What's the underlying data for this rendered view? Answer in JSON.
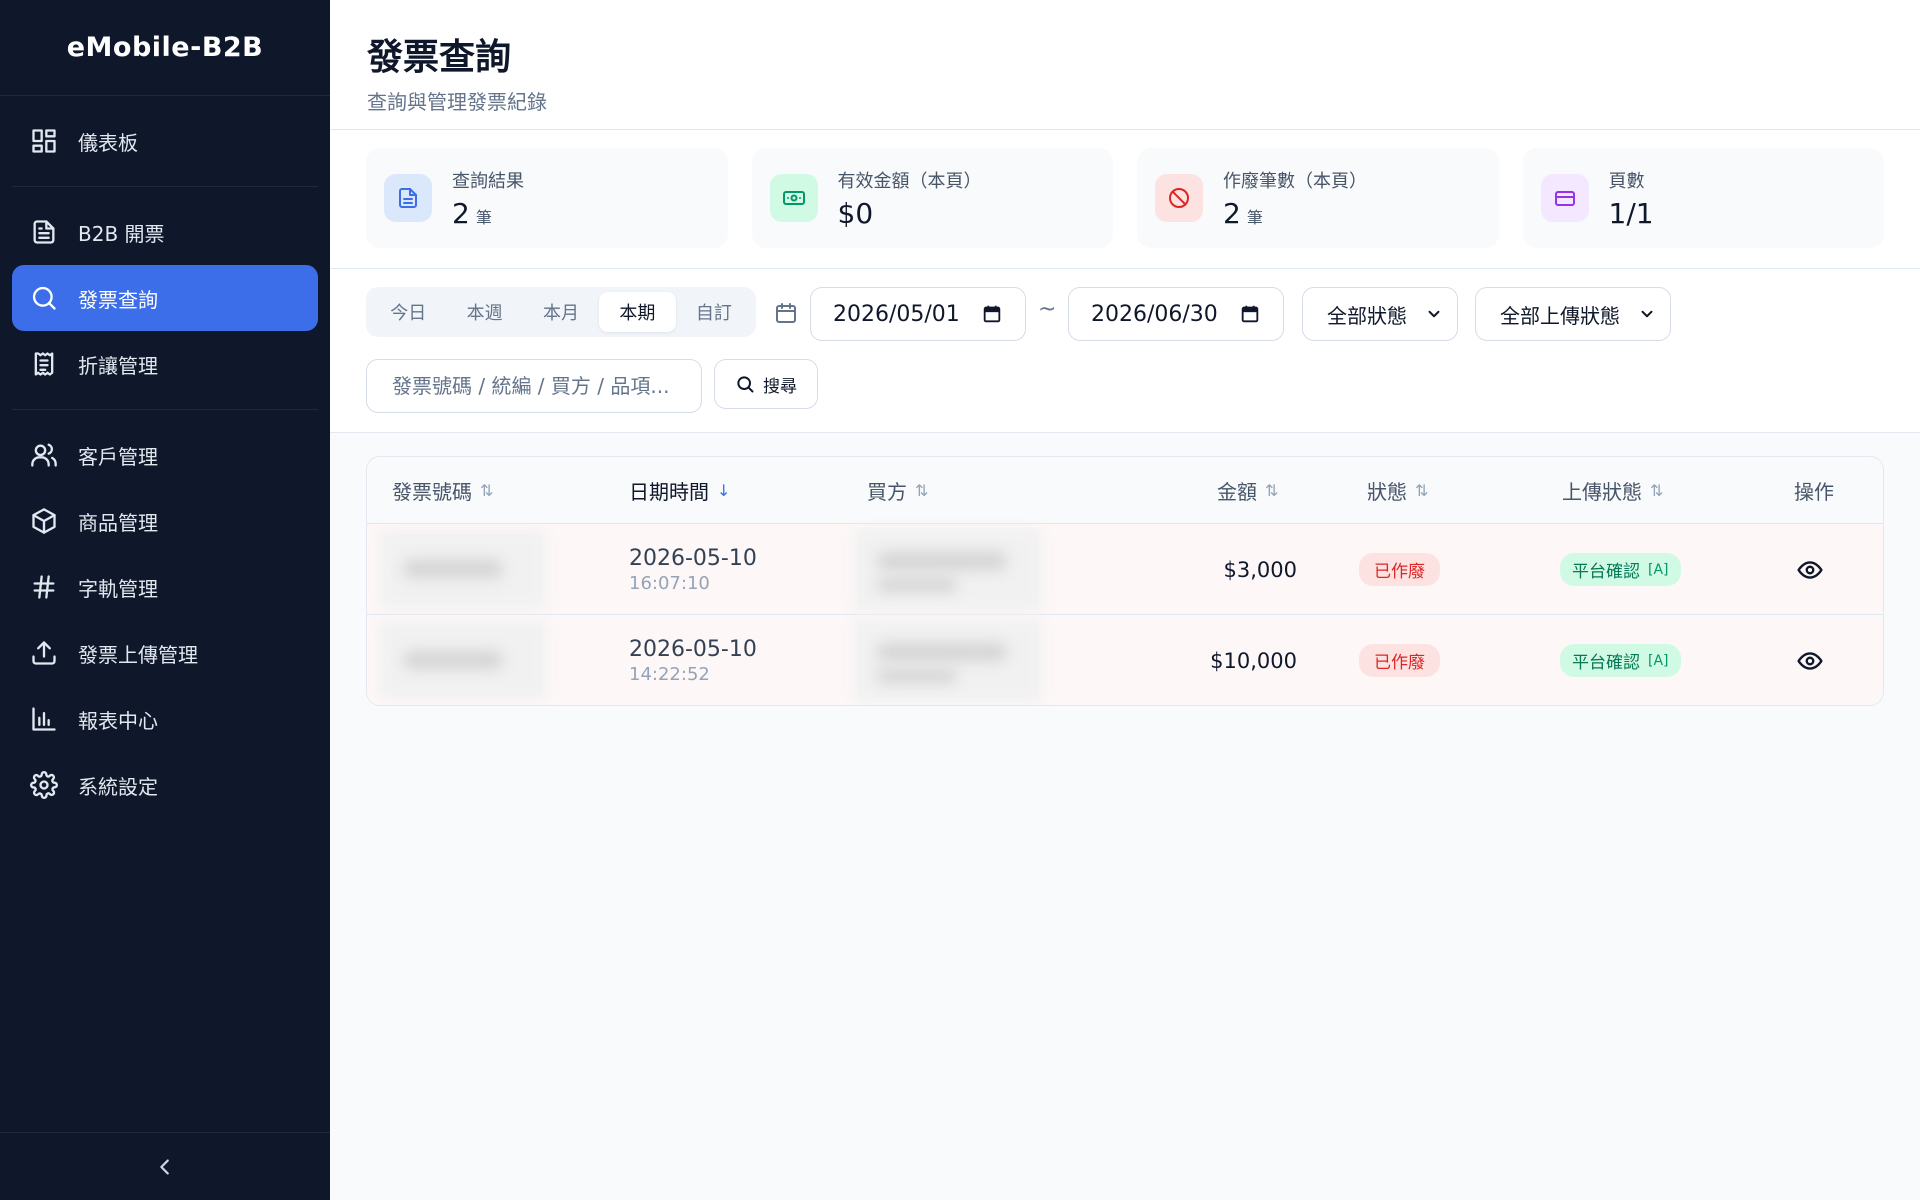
{
  "app": {
    "brand": "eMobile-B2B"
  },
  "sidebar": {
    "items": [
      {
        "label": "儀表板",
        "icon": "dashboard-grid-icon"
      },
      {
        "label": "B2B 開票",
        "icon": "document-icon"
      },
      {
        "label": "發票查詢",
        "icon": "search-icon",
        "active": true
      },
      {
        "label": "折讓管理",
        "icon": "receipt-icon"
      },
      {
        "label": "客戶管理",
        "icon": "users-icon"
      },
      {
        "label": "商品管理",
        "icon": "package-icon"
      },
      {
        "label": "字軌管理",
        "icon": "hash-icon"
      },
      {
        "label": "發票上傳管理",
        "icon": "upload-icon"
      },
      {
        "label": "報表中心",
        "icon": "bar-chart-icon"
      },
      {
        "label": "系統設定",
        "icon": "gear-icon"
      }
    ]
  },
  "header": {
    "title": "發票查詢",
    "subtitle": "查詢與管理發票紀錄"
  },
  "stats": [
    {
      "label": "查詢結果",
      "value": "2",
      "unit": "筆",
      "icon": "file-text-icon",
      "color": "#3b6ee8",
      "bg": "#dbe7fb"
    },
    {
      "label": "有效金額（本頁）",
      "value": "$0",
      "unit": "",
      "icon": "banknote-icon",
      "color": "#059669",
      "bg": "#d1fae5"
    },
    {
      "label": "作廢筆數（本頁）",
      "value": "2",
      "unit": "筆",
      "icon": "ban-icon",
      "color": "#dc2626",
      "bg": "#fde2e2"
    },
    {
      "label": "頁數",
      "value": "1/1",
      "unit": "",
      "icon": "credit-card-icon",
      "color": "#9333ea",
      "bg": "#f3e8ff"
    }
  ],
  "filters": {
    "ranges": [
      "今日",
      "本週",
      "本月",
      "本期",
      "自訂"
    ],
    "active_range": "本期",
    "date_from": "2026/05/01",
    "date_to": "2026/06/30",
    "separator": "~",
    "status_select": "全部狀態",
    "upload_select": "全部上傳狀態",
    "search_placeholder": "發票號碼 / 統編 / 買方 / 品項...",
    "search_button": "搜尋"
  },
  "table": {
    "columns": [
      "發票號碼",
      "日期時間",
      "買方",
      "金額",
      "狀態",
      "上傳狀態",
      "操作"
    ],
    "rows": [
      {
        "date": "2026-05-10",
        "time": "16:07:10",
        "amount": "$3,000",
        "status": "已作廢",
        "upload": "平台確認",
        "upload_tag": "[A]"
      },
      {
        "date": "2026-05-10",
        "time": "14:22:52",
        "amount": "$10,000",
        "status": "已作廢",
        "upload": "平台確認",
        "upload_tag": "[A]"
      }
    ]
  }
}
